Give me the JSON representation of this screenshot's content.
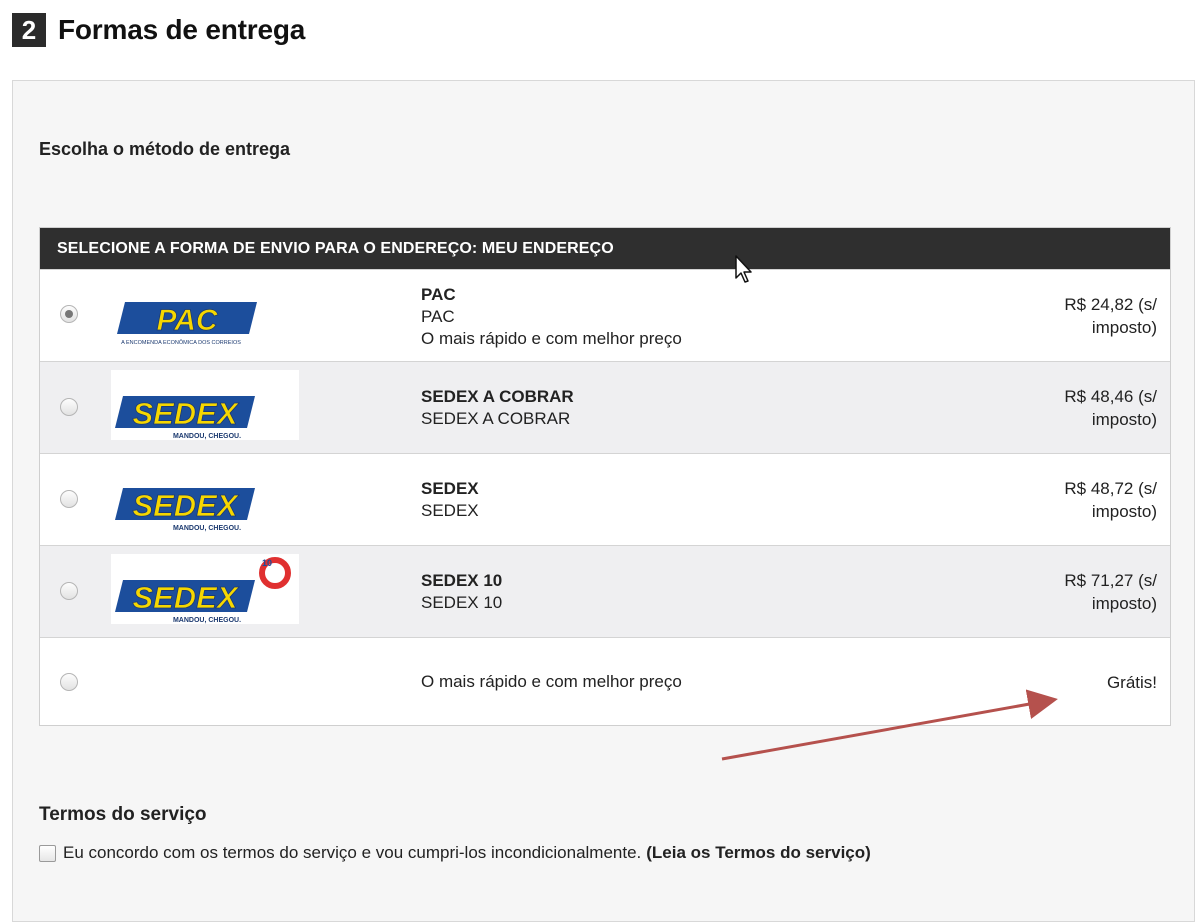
{
  "header": {
    "step_number": "2",
    "title": "Formas de entrega"
  },
  "section": {
    "choose_title": "Escolha o método de entrega"
  },
  "shipping": {
    "table_header": "SELECIONE A FORMA DE ENVIO PARA O ENDEREÇO: MEU ENDEREÇO",
    "options": [
      {
        "logo": "PAC",
        "logo_tagline": "A ENCOMENDA ECONÔMICA DOS CORREIOS",
        "name": "PAC",
        "subname": "PAC",
        "description": "O mais rápido e com melhor preço",
        "price_line1": "R$ 24,82 (s/",
        "price_line2": "imposto)",
        "selected": true
      },
      {
        "logo": "SEDEX",
        "logo_tagline": "MANDOU, CHEGOU.",
        "name": "SEDEX A COBRAR",
        "subname": "SEDEX A COBRAR",
        "price_line1": "R$ 48,46 (s/",
        "price_line2": "imposto)",
        "selected": false
      },
      {
        "logo": "SEDEX",
        "logo_tagline": "MANDOU, CHEGOU.",
        "name": "SEDEX",
        "subname": "SEDEX",
        "price_line1": "R$ 48,72 (s/",
        "price_line2": "imposto)",
        "selected": false
      },
      {
        "logo": "SEDEX",
        "logo_badge": "10",
        "logo_tagline": "MANDOU, CHEGOU.",
        "name": "SEDEX 10",
        "subname": "SEDEX 10",
        "price_line1": "R$ 71,27 (s/",
        "price_line2": "imposto)",
        "selected": false
      },
      {
        "description": "O mais rápido e com melhor preço",
        "price_line1": "Grátis!",
        "selected": false
      }
    ]
  },
  "terms": {
    "title": "Termos do serviço",
    "agree_text": "Eu concordo com os termos do serviço e vou cumpri-los incondicionalmente.",
    "link_text": "(Leia os Termos do serviço)",
    "checked": false
  },
  "colors": {
    "header_bar": "#2f2f2f",
    "pac_blue": "#1c4e9c",
    "sedex_yellow": "#f6d700",
    "annotation_arrow": "#b5514d"
  }
}
